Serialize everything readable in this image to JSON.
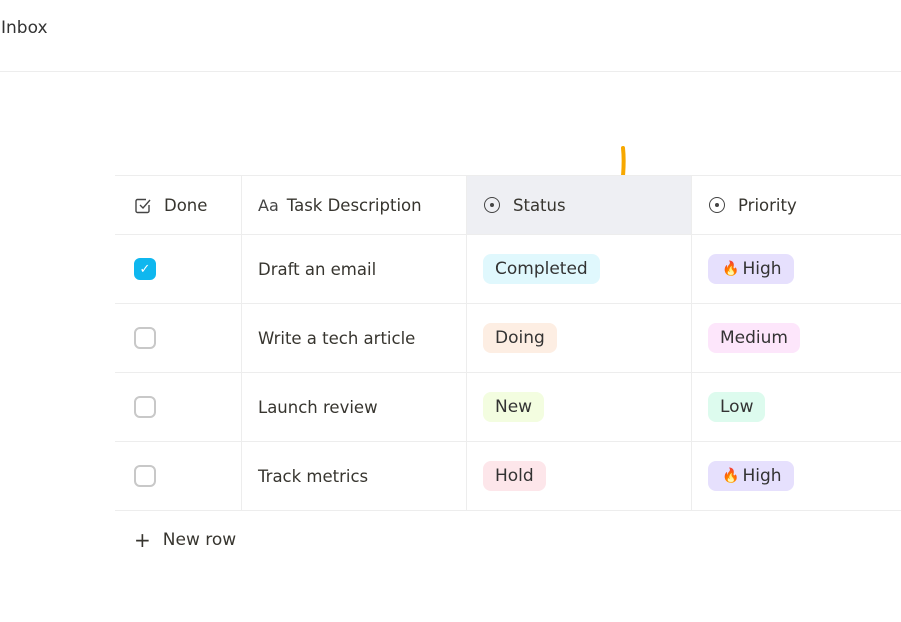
{
  "header": {
    "title": "Inbox"
  },
  "columns": [
    {
      "label": "Done",
      "icon": "checkbox-icon"
    },
    {
      "label": "Task Description",
      "icon_text": "Aa"
    },
    {
      "label": "Status",
      "icon": "select-icon"
    },
    {
      "label": "Priority",
      "icon": "select-icon"
    }
  ],
  "rows": [
    {
      "done": true,
      "task": "Draft an email",
      "status": "Completed",
      "status_color": "#e0f8fd",
      "priority": "High",
      "priority_emoji": "🔥",
      "priority_color": "#e6e0fd"
    },
    {
      "done": false,
      "task": "Write a tech article",
      "status": "Doing",
      "status_color": "#fdeee3",
      "priority": "Medium",
      "priority_emoji": "",
      "priority_color": "#fde6fb"
    },
    {
      "done": false,
      "task": "Launch review",
      "status": "New",
      "status_color": "#f3fde0",
      "priority": "Low",
      "priority_emoji": "",
      "priority_color": "#ddfbee"
    },
    {
      "done": false,
      "task": "Track metrics",
      "status": "Hold",
      "status_color": "#fde6ea",
      "priority": "High",
      "priority_emoji": "🔥",
      "priority_color": "#e6e0fd"
    }
  ],
  "new_row": {
    "label": "New row",
    "icon": "+"
  },
  "colors": {
    "accent": "#0fb7ef",
    "annotation": "#f7a800"
  }
}
